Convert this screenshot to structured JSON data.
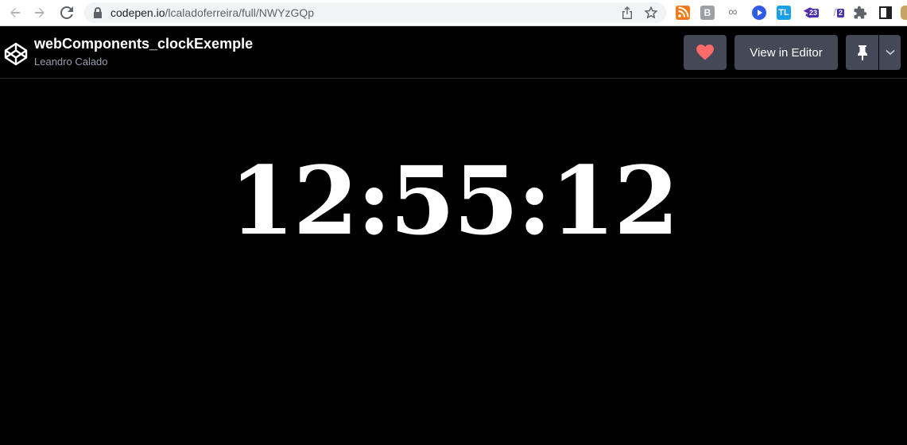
{
  "browser": {
    "url_host": "codepen.io",
    "url_path": "/lcaladoferreira/full/NWYzGQp",
    "extensions": [
      {
        "name": "rss-icon"
      },
      {
        "name": "b-extension-icon",
        "label": "B"
      },
      {
        "name": "infinity-icon",
        "label": "∞"
      },
      {
        "name": "play-circle-icon"
      },
      {
        "name": "tl-extension-icon",
        "label": "TL"
      },
      {
        "name": "graduation-cap-icon",
        "badge": "23"
      },
      {
        "name": "lambda-icon",
        "label": "/\\",
        "badge": "2"
      },
      {
        "name": "puzzle-icon"
      },
      {
        "name": "side-panel-icon"
      }
    ]
  },
  "header": {
    "title": "webComponents_clockExemple",
    "author": "Leandro Calado",
    "view_in_editor_label": "View in Editor",
    "heart_color": "#ff6b6b",
    "button_color": "#444857"
  },
  "clock": {
    "time": "12:55:12"
  }
}
